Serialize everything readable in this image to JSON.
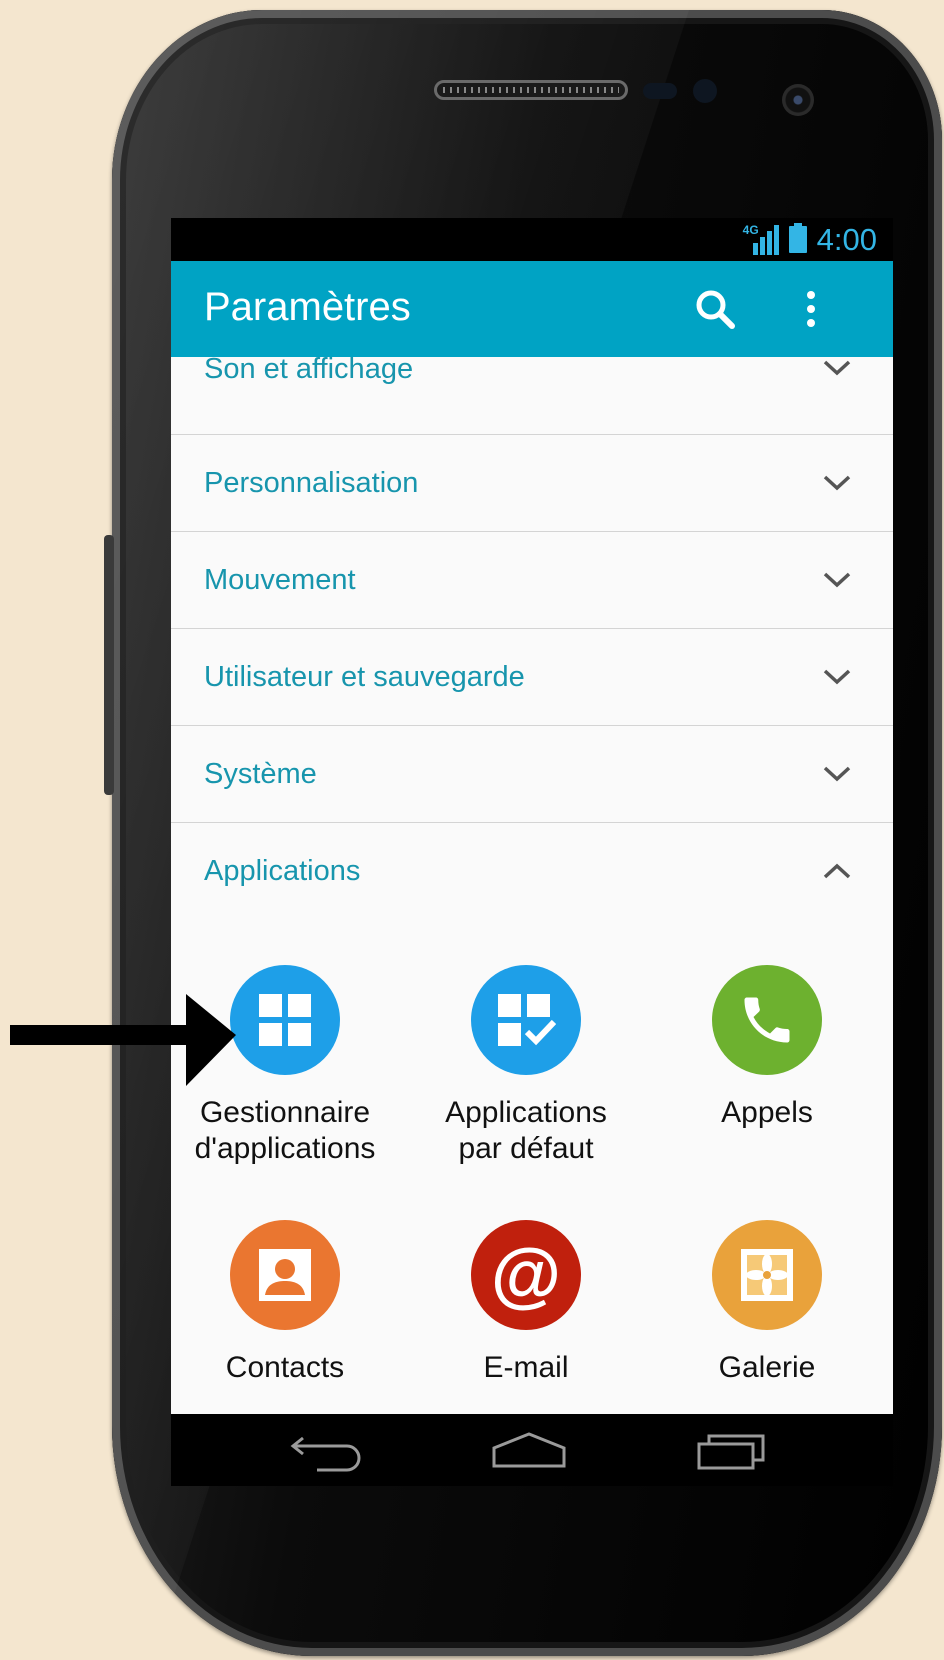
{
  "status_bar": {
    "network": "4G",
    "time": "4:00"
  },
  "app_bar": {
    "title": "Paramètres"
  },
  "sections": [
    {
      "label": "Son et affichage",
      "expanded": false
    },
    {
      "label": "Personnalisation",
      "expanded": false
    },
    {
      "label": "Mouvement",
      "expanded": false
    },
    {
      "label": "Utilisateur et sauvegarde",
      "expanded": false
    },
    {
      "label": "Système",
      "expanded": false
    },
    {
      "label": "Applications",
      "expanded": true
    }
  ],
  "apps": [
    {
      "line1": "Gestionnaire",
      "line2": "d'applications",
      "icon": "grid-icon",
      "color": "#1e9fe8"
    },
    {
      "line1": "Applications",
      "line2": "par défaut",
      "icon": "grid-check-icon",
      "color": "#1e9fe8"
    },
    {
      "line1": "Appels",
      "line2": "",
      "icon": "phone-icon",
      "color": "#6db12f"
    },
    {
      "line1": "Contacts",
      "line2": "",
      "icon": "contact-icon",
      "color": "#ea7630"
    },
    {
      "line1": "E-mail",
      "line2": "",
      "icon": "at-icon",
      "color": "#c0200d"
    },
    {
      "line1": "Galerie",
      "line2": "",
      "icon": "gallery-icon",
      "color": "#e9a23b"
    }
  ],
  "colors": {
    "app_bar": "#00a3c4",
    "section_text": "#1795ad",
    "status_accent": "#33b5e5",
    "page_background": "#f4e6cf"
  },
  "nav_bar": {
    "icons": [
      "back-icon",
      "home-icon",
      "recents-icon"
    ]
  },
  "annotation": {
    "icon": "pointer-arrow-icon",
    "points_to": "Gestionnaire d'applications"
  }
}
